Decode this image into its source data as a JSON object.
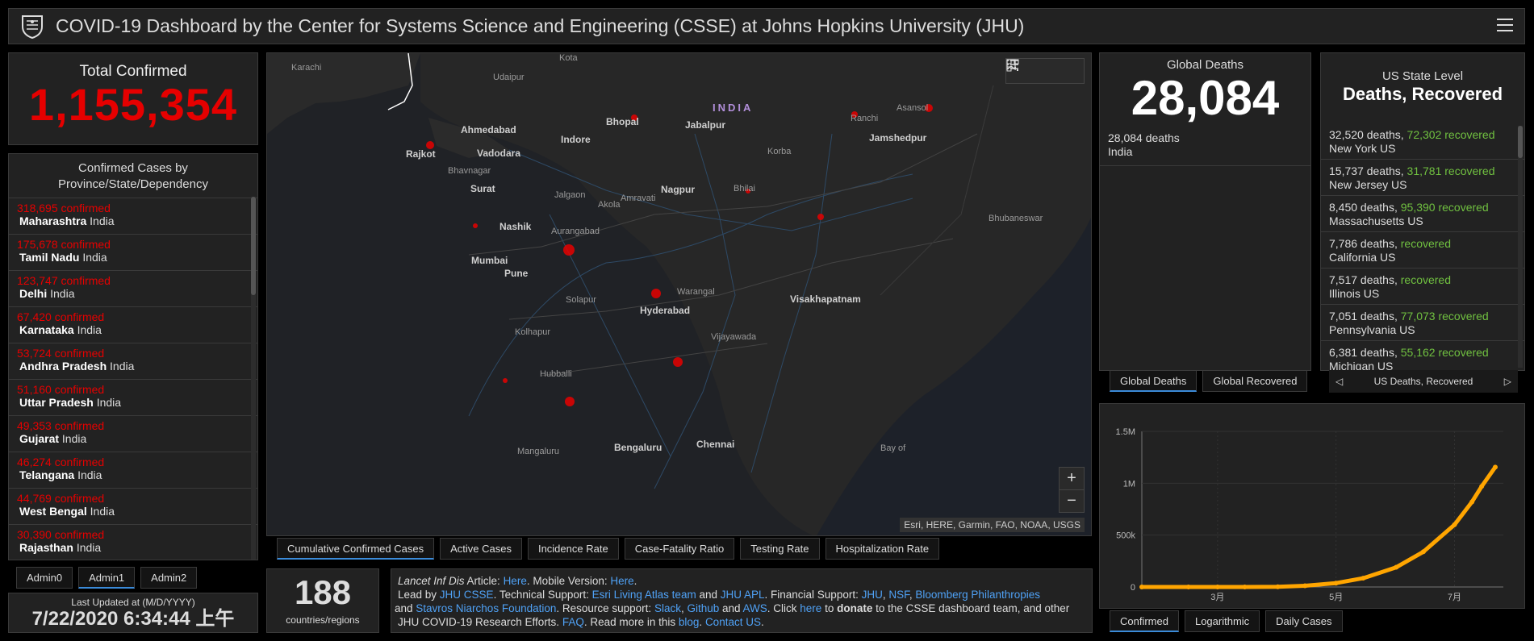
{
  "header": {
    "title": "COVID-19 Dashboard by the Center for Systems Science and Engineering (CSSE) at Johns Hopkins University (JHU)"
  },
  "total": {
    "label": "Total Confirmed",
    "value": "1,155,354"
  },
  "provinces": {
    "heading": "Confirmed Cases by Province/State/Dependency",
    "items": [
      {
        "count": "318,695 confirmed",
        "name": "Maharashtra",
        "country": "India"
      },
      {
        "count": "175,678 confirmed",
        "name": "Tamil Nadu",
        "country": "India"
      },
      {
        "count": "123,747 confirmed",
        "name": "Delhi",
        "country": "India"
      },
      {
        "count": "67,420 confirmed",
        "name": "Karnataka",
        "country": "India"
      },
      {
        "count": "53,724 confirmed",
        "name": "Andhra Pradesh",
        "country": "India"
      },
      {
        "count": "51,160 confirmed",
        "name": "Uttar Pradesh",
        "country": "India"
      },
      {
        "count": "49,353 confirmed",
        "name": "Gujarat",
        "country": "India"
      },
      {
        "count": "46,274 confirmed",
        "name": "Telangana",
        "country": "India"
      },
      {
        "count": "44,769 confirmed",
        "name": "West Bengal",
        "country": "India"
      },
      {
        "count": "30,390 confirmed",
        "name": "Rajasthan",
        "country": "India"
      }
    ]
  },
  "admin_tabs": [
    "Admin0",
    "Admin1",
    "Admin2"
  ],
  "updated": {
    "label": "Last Updated at (M/D/YYYY)",
    "value": "7/22/2020 6:34:44 上午"
  },
  "map": {
    "country_label": "INDIA",
    "attribution": "Esri, HERE, Garmin, FAO, NOAA, USGS",
    "zoom_in": "+",
    "zoom_out": "−",
    "tools": [
      "bookmark-icon",
      "list-icon",
      "qr-code-icon"
    ],
    "cities": [
      "Karachi",
      "Kota",
      "Udaipur",
      "Bhopal",
      "Jabalpur",
      "Ranchi",
      "Asansol",
      "Ahmedabad",
      "Indore",
      "Jamshedpur",
      "Rajkot",
      "Vadodara",
      "Korba",
      "Bhavnagar",
      "Surat",
      "Jalgaon",
      "Akola",
      "Amravati",
      "Nagpur",
      "Bhilai",
      "Bhubaneswar",
      "Nashik",
      "Aurangabad",
      "Mumbai",
      "Pune",
      "Solapur",
      "Warangal",
      "Hyderabad",
      "Visakhapatnam",
      "Kolhapur",
      "Vijayawada",
      "Hubballi",
      "Bengaluru",
      "Chennai",
      "Mangaluru",
      "Bay of"
    ],
    "case_markers": [
      {
        "label": "Rajkot",
        "value": "small"
      },
      {
        "label": "Bhopal",
        "value": "small"
      },
      {
        "label": "Ranchi",
        "value": "small"
      },
      {
        "label": "Asansol",
        "value": "small"
      },
      {
        "label": "Bhilai",
        "value": "small"
      },
      {
        "label": "Bhubaneswar region",
        "value": "small"
      },
      {
        "label": "Mumbai coast",
        "value": "small"
      },
      {
        "label": "Aurangabad",
        "value": "medium"
      },
      {
        "label": "Hyderabad region",
        "value": "medium"
      },
      {
        "label": "Vijayawada region",
        "value": "medium"
      },
      {
        "label": "Bengaluru region",
        "value": "medium"
      },
      {
        "label": "Mangaluru coast",
        "value": "small"
      }
    ]
  },
  "map_tabs": [
    "Cumulative Confirmed Cases",
    "Active Cases",
    "Incidence Rate",
    "Case-Fatality Ratio",
    "Testing Rate",
    "Hospitalization Rate"
  ],
  "countries": {
    "value": "188",
    "label": "countries/regions"
  },
  "info": {
    "article_prefix": "Lancet Inf Dis",
    "article_text": " Article: ",
    "here1": "Here",
    "mobile_text": ". Mobile Version: ",
    "here2": "Here",
    "lead_text": "Lead by ",
    "jhu_csse": "JHU CSSE",
    "tech_text": ". Technical Support: ",
    "esri": "Esri Living Atlas team",
    "and1": " and ",
    "jhu_apl": "JHU APL",
    "fin_text": ". Financial Support: ",
    "jhu": "JHU",
    "comma1": ", ",
    "nsf": "NSF",
    "comma2": ", ",
    "bloomberg": "Bloomberg Philanthropies",
    "and2": " and ",
    "stavros": "Stavros Niarchos Foundation",
    "res_text": ". Resource support: ",
    "slack": "Slack",
    "comma3": ", ",
    "github": "Github",
    "and3": " and ",
    "aws": "AWS",
    "click_text": ". Click ",
    "here3": "here",
    "to_text": " to ",
    "donate": "donate",
    "donate_rest": " to the CSSE dashboard team, and other JHU COVID-19 Research Efforts. ",
    "faq": "FAQ",
    "read_text": ". Read more in this ",
    "blog": "blog",
    "dot": ". ",
    "contact": "Contact US",
    "end": "."
  },
  "deaths": {
    "label": "Global Deaths",
    "value": "28,084",
    "row_count": "28,084",
    "row_unit": " deaths",
    "row_country": "India"
  },
  "deaths_tabs": [
    "Global Deaths",
    "Global Recovered"
  ],
  "us": {
    "label": "US State Level",
    "title": "Deaths, Recovered",
    "items": [
      {
        "deaths": "32,520",
        "recovered": "72,302",
        "name": "New York US"
      },
      {
        "deaths": "15,737",
        "recovered": "31,781",
        "name": "New Jersey US"
      },
      {
        "deaths": "8,450",
        "recovered": "95,390",
        "name": "Massachusetts US"
      },
      {
        "deaths": "7,786",
        "recovered": "",
        "name": "California US"
      },
      {
        "deaths": "7,517",
        "recovered": "",
        "name": "Illinois US"
      },
      {
        "deaths": "7,051",
        "recovered": "77,073",
        "name": "Pennsylvania US"
      },
      {
        "deaths": "6,381",
        "recovered": "55,162",
        "name": "Michigan US"
      }
    ],
    "deaths_word": " deaths, ",
    "recovered_word": " recovered",
    "pager_label": "US Deaths, Recovered"
  },
  "chart_tabs": [
    "Confirmed",
    "Logarithmic",
    "Daily Cases"
  ],
  "colors": {
    "confirmed": "#e60000",
    "recovered": "#70c040",
    "chart_line": "#ffa500",
    "accent": "#3b8bd9"
  },
  "chart_data": {
    "type": "line",
    "x": [
      "2020-01-22",
      "2020-02-15",
      "2020-03-01",
      "2020-03-15",
      "2020-04-01",
      "2020-04-15",
      "2020-05-01",
      "2020-05-15",
      "2020-06-01",
      "2020-06-15",
      "2020-07-01",
      "2020-07-10",
      "2020-07-15",
      "2020-07-22"
    ],
    "y": [
      0,
      0,
      0,
      100,
      2000,
      12000,
      37000,
      85000,
      190000,
      340000,
      600000,
      820000,
      970000,
      1155354
    ],
    "xticks": [
      "3月",
      "5月",
      "7月"
    ],
    "yticks": [
      "0",
      "500k",
      "1M",
      "1.5M"
    ],
    "ylim": [
      0,
      1500000
    ],
    "xlabel": "",
    "ylabel": "",
    "grid": true
  }
}
